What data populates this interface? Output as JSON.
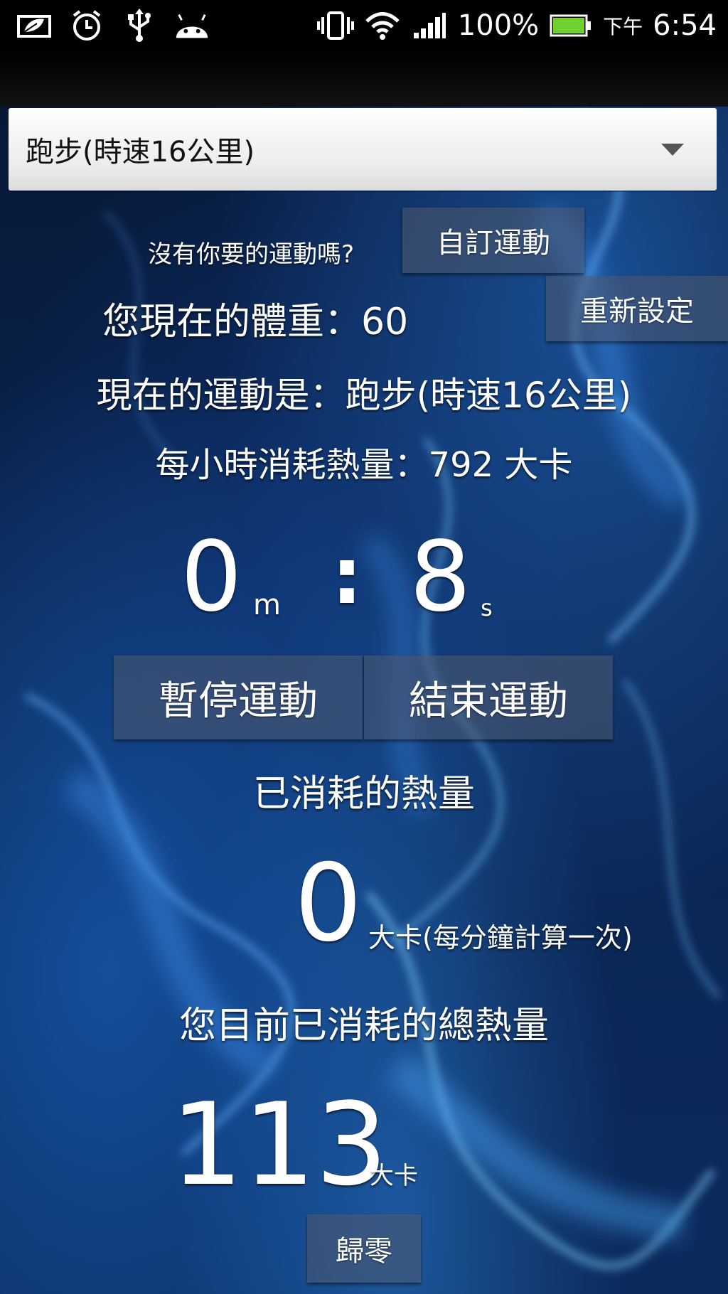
{
  "status_bar": {
    "icons_left": [
      "leaf-mail-icon",
      "alarm-clock-icon",
      "usb-icon",
      "android-icon"
    ],
    "icons_right": [
      "vibrate-icon",
      "wifi-icon",
      "signal-icon",
      "battery-icon"
    ],
    "battery_percent": "100%",
    "battery_level": 1.0,
    "ampm": "下午",
    "time": "6:54"
  },
  "exercise_spinner": {
    "selected": "跑步(時速16公里)"
  },
  "custom_prompt": "沒有你要的運動嗎?",
  "custom_button": "自訂運動",
  "weight_text": "您現在的體重：60",
  "reset_button": "重新設定",
  "current_exercise_text": "現在的運動是：跑步(時速16公里)",
  "calories_per_hour_text": "每小時消耗熱量：792 大卡",
  "timer": {
    "minutes": "0",
    "minutes_unit": "m",
    "separator": ":",
    "seconds": "8",
    "seconds_unit": "s"
  },
  "pause_button": "暫停運動",
  "end_button": "結束運動",
  "burned_title": "已消耗的熱量",
  "burned_value": "0",
  "burned_unit": "大卡(每分鐘計算一次)",
  "total_title": "您目前已消耗的總熱量",
  "total_value": "113",
  "total_unit": "大卡",
  "zero_button": "歸零",
  "colors": {
    "statusbar_bg": "#000000",
    "background": "#0a2550",
    "accent_blue": "#3a8ee8",
    "battery_green": "#6fd12c",
    "button_bg": "#505a6e"
  }
}
